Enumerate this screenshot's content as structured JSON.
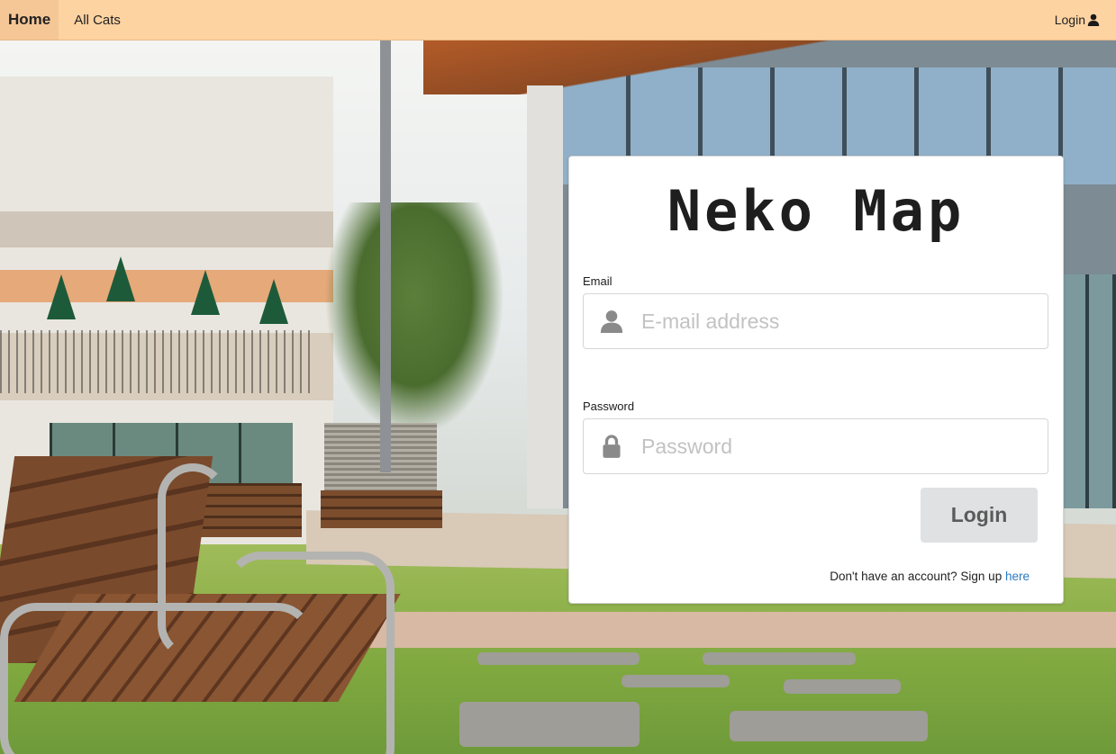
{
  "navbar": {
    "home_label": "Home",
    "all_cats_label": "All Cats",
    "login_label": "Login",
    "login_icon": "user-icon"
  },
  "login_card": {
    "logo_text": "Neko Map",
    "email_label": "Email",
    "email_placeholder": "E-mail address",
    "email_value": "",
    "email_icon": "user-icon",
    "password_label": "Password",
    "password_placeholder": "Password",
    "password_value": "",
    "password_icon": "lock-icon",
    "login_button_label": "Login",
    "signup_prompt": "Don't have an account? Sign up",
    "signup_link": "here"
  },
  "colors": {
    "navbar_bg": "#fdd3a2",
    "active_nav_bg": "#f6c796",
    "button_bg": "#e0e1e2",
    "link": "#2a7ac0"
  }
}
